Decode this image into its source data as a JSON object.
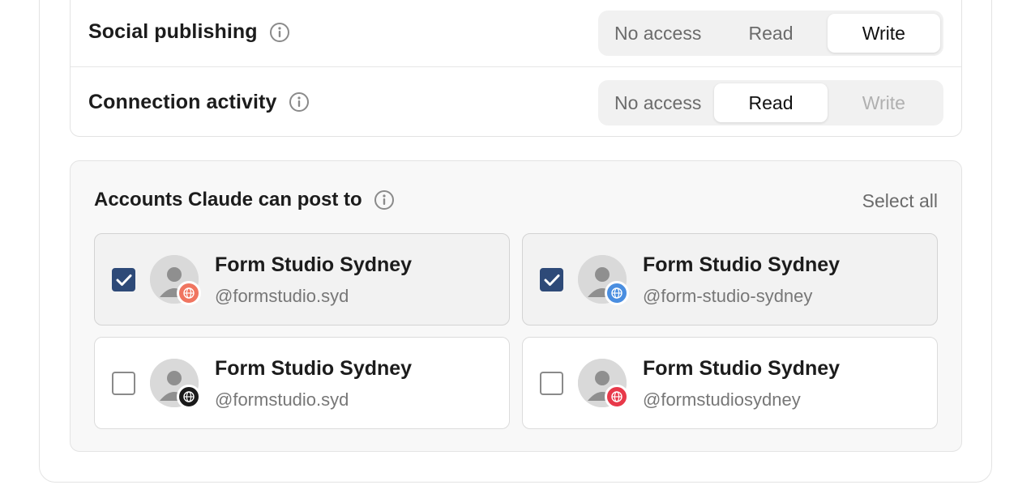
{
  "permissions": [
    {
      "label": "Social publishing",
      "options": [
        "No access",
        "Read",
        "Write"
      ],
      "selected": "Write",
      "disabled": []
    },
    {
      "label": "Connection activity",
      "options": [
        "No access",
        "Read",
        "Write"
      ],
      "selected": "Read",
      "disabled": [
        "Write"
      ]
    }
  ],
  "accounts": {
    "title": "Accounts Claude can post to",
    "select_all_label": "Select all",
    "items": [
      {
        "name": "Form Studio Sydney",
        "handle": "@formstudio.syd",
        "checked": true,
        "badge_color": "#f07560",
        "badge_icon": "globe-icon"
      },
      {
        "name": "Form Studio Sydney",
        "handle": "@form-studio-sydney",
        "checked": true,
        "badge_color": "#4a8ee0",
        "badge_icon": "globe-icon"
      },
      {
        "name": "Form Studio Sydney",
        "handle": "@formstudio.syd",
        "checked": false,
        "badge_color": "#1a1a1a",
        "badge_icon": "globe-icon"
      },
      {
        "name": "Form Studio Sydney",
        "handle": "@formstudiosydney",
        "checked": false,
        "badge_color": "#e8394a",
        "badge_icon": "globe-icon"
      }
    ]
  },
  "colors": {
    "checkbox_checked": "#2e4a78",
    "border": "#e3e3e3",
    "muted_text": "#6b6b6b"
  }
}
